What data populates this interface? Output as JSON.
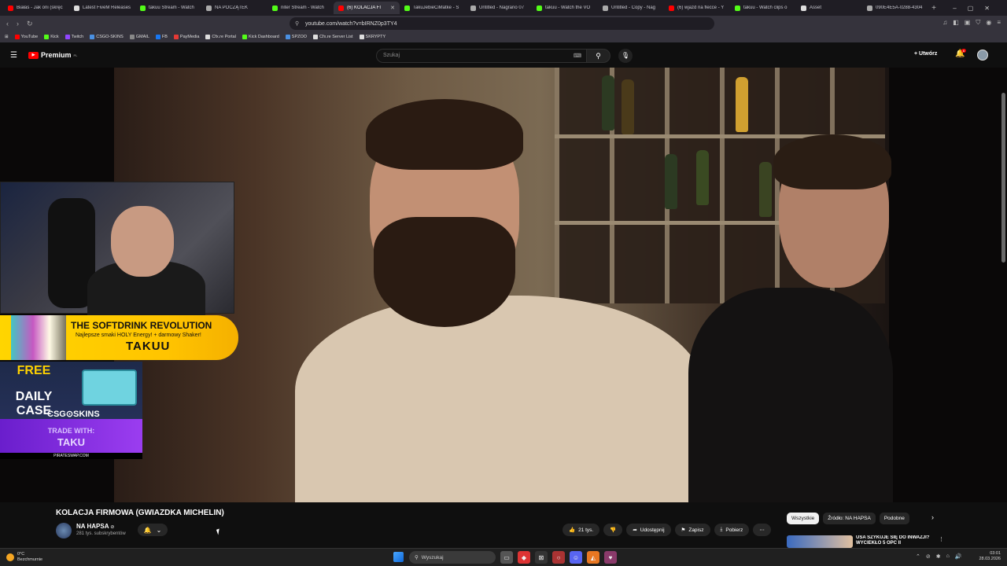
{
  "browser": {
    "tabs": [
      {
        "label": "Białas - Jak oni (skręc",
        "color": "#ff0000"
      },
      {
        "label": "Latest FiveM Releases",
        "color": "#dddddd"
      },
      {
        "label": "takuu Stream - Watch",
        "color": "#53fc18"
      },
      {
        "label": "NA POCZĄTEK",
        "color": "#aaaaaa"
      },
      {
        "label": "niter Stream - Watch",
        "color": "#53fc18"
      },
      {
        "label": "(6) KOLACJA FI",
        "color": "#ff0000",
        "active": true
      },
      {
        "label": "TakuJebieCiMatke - S",
        "color": "#53fc18"
      },
      {
        "label": "Untitled - Nagrano 07",
        "color": "#aaaaaa"
      },
      {
        "label": "takuu - Watch the VO",
        "color": "#53fc18"
      },
      {
        "label": "Untitled - Copy - Nag",
        "color": "#aaaaaa"
      },
      {
        "label": "(6) wjazd na flecce - Y",
        "color": "#ff0000"
      },
      {
        "label": "takuu - Watch clips o",
        "color": "#53fc18"
      },
      {
        "label": "Asset",
        "color": "#dddddd"
      },
      {
        "label": "090E4E5A-0288-4304",
        "color": "#aaaaaa"
      }
    ],
    "new_tab": "+",
    "window_controls": {
      "minimize": "–",
      "maximize": "▢",
      "close": "✕"
    },
    "url": "youtube.com/watch?v=bIRNZ0p3TY4",
    "bookmarks": [
      {
        "label": "YouTube",
        "color": "#ff0000"
      },
      {
        "label": "Kick",
        "color": "#53fc18"
      },
      {
        "label": "Twitch",
        "color": "#9146ff"
      },
      {
        "label": "CSGO-SKINS",
        "color": "#4a90e2"
      },
      {
        "label": "GMAIL",
        "color": "#888888"
      },
      {
        "label": "FB",
        "color": "#1877f2"
      },
      {
        "label": "PayMedia",
        "color": "#e53935"
      },
      {
        "label": "Cfx.re Portal",
        "color": "#dddddd"
      },
      {
        "label": "Kick Dashboard",
        "color": "#53fc18"
      },
      {
        "label": "SPZOO",
        "color": "#4a90e2"
      },
      {
        "label": "Cfx.re Server List",
        "color": "#dddddd"
      },
      {
        "label": "SKRYPTY",
        "color": "#dddddd"
      }
    ]
  },
  "youtube": {
    "logo_text": "Premium",
    "logo_region": "PL",
    "search_placeholder": "Szukaj",
    "create_label": "Utwórz",
    "notification_count": "6",
    "overlay": {
      "banner_title": "THE SOFTDRINK REVOLUTION",
      "banner_subtitle": "Najlepsze smaki HOLY Energy! + darmowy Shaker!",
      "banner_code": "TAKUU",
      "csg_free": "FREE",
      "csg_daily_case": "DAILY CASE",
      "csg_logo": "CSG⊙SKINS",
      "trade_with": "TRADE WITH:",
      "trade_name": "TAKU",
      "pirateswap": "PIRATESWAP.COM"
    },
    "video": {
      "title": "KOLACJA FIRMOWA (GWIAZDKA MICHELIN)",
      "channel_name": "NA HAPSA",
      "channel_subs": "281 tys. subskrybentów",
      "likes": "21 tys.",
      "share": "Udostępnij",
      "save": "Zapisz",
      "download": "Pobierz",
      "more": "⋯"
    },
    "chips": [
      "Wszystkie",
      "Źródło: NA HAPSA",
      "Podobne"
    ],
    "recommended": {
      "title": "USA SZYKUJE SIĘ DO INWAZJI? WYCIEKŁO 5 OPC II"
    }
  },
  "taskbar": {
    "weather_temp": "0°C",
    "weather_desc": "Bezchmurnie",
    "search_label": "Wyszukaj",
    "time": "03:01",
    "date": "28.03.2026"
  }
}
